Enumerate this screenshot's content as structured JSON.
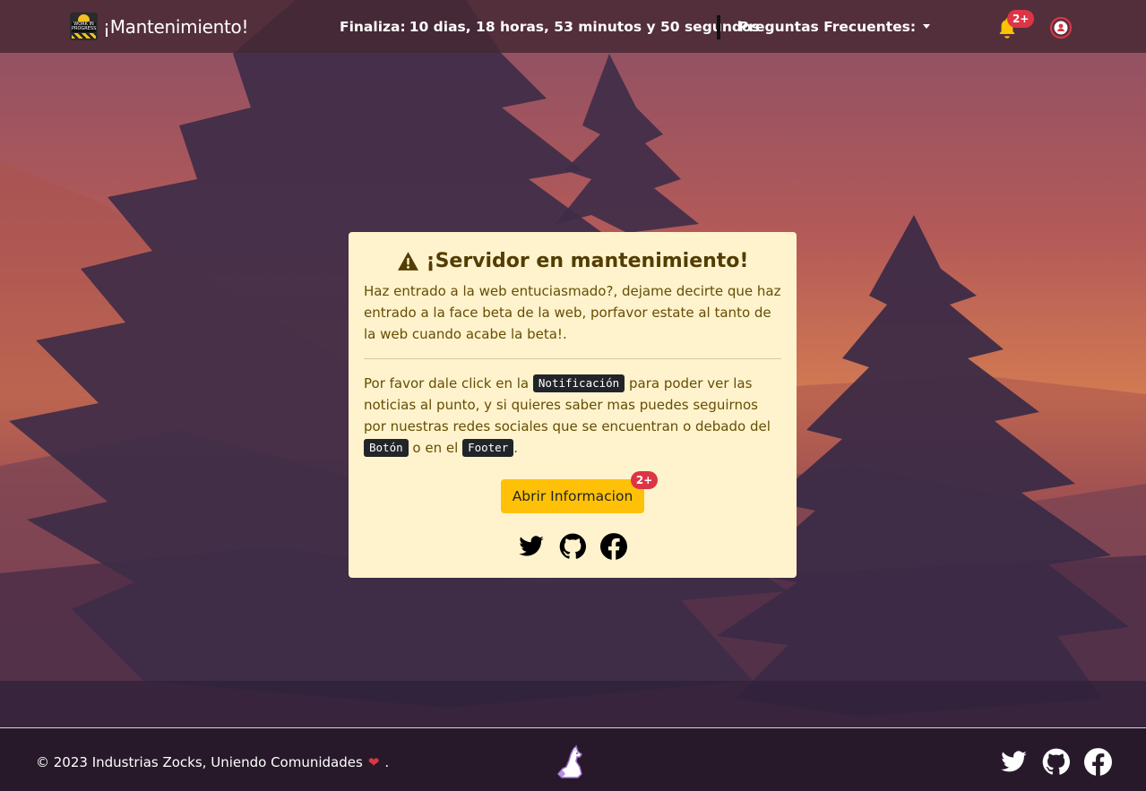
{
  "navbar": {
    "brand_title": "¡Mantenimiento!",
    "logo_text": "WORK IN PROGRESS",
    "countdown_label": "Finaliza:",
    "countdown_value": "10 dias, 18 horas, 53 minutos y 50 segundos",
    "faq_label": "Preguntas Frecuentes:",
    "notification_badge": "2+",
    "icons": [
      "bell-icon",
      "user-icon"
    ]
  },
  "card": {
    "title": "¡Servidor en mantenimiento!",
    "intro": "Haz entrado a la web entuciasmado?, dejame decirte que haz entrado a la face beta de la web, porfavor estate al tanto de la web cuando acabe la beta!.",
    "body_part1": "Por favor dale click en la",
    "kbd_notification": "Notificación",
    "body_part2": "para poder ver las noticias al punto, y si quieres saber mas puedes seguirnos por nuestras redes sociales que se encuentran o debado del",
    "kbd_button": "Botón",
    "body_part3": "o en el",
    "kbd_footer": "Footer",
    "body_end": ".",
    "button_label": "Abrir Informacion",
    "button_badge": "2+",
    "socials": [
      "twitter-icon",
      "github-icon",
      "facebook-icon"
    ]
  },
  "footer": {
    "copyright": "© 2023 Industrias Zocks, Uniendo Comunidades",
    "copyright_end": ".",
    "heart": "❤",
    "socials": [
      "twitter-icon",
      "github-icon",
      "facebook-icon"
    ]
  },
  "colors": {
    "warning_bg": "#fff3cd",
    "warning_text": "#664d03",
    "button_yellow": "#ffc107",
    "badge_red": "#dc3545",
    "bell_yellow": "#ffc107"
  }
}
